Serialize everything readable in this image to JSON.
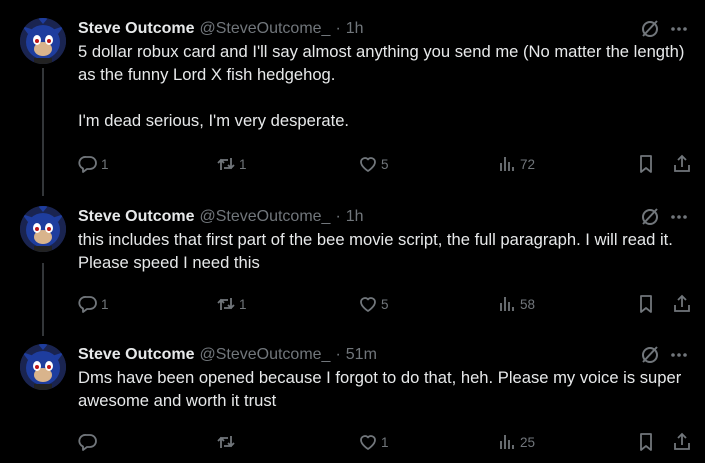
{
  "tweets": [
    {
      "name": "Steve Outcome",
      "handle": "@SteveOutcome_",
      "separator": "·",
      "time": "1h",
      "paragraphs": [
        "5 dollar robux card and I'll say almost anything you send me (No matter the length) as the funny Lord X fish hedgehog.",
        "I'm dead serious, I'm very desperate."
      ],
      "replies": "1",
      "reposts": "1",
      "likes": "5",
      "views": "72"
    },
    {
      "name": "Steve Outcome",
      "handle": "@SteveOutcome_",
      "separator": "·",
      "time": "1h",
      "paragraphs": [
        "this includes that first part of the bee movie script, the full paragraph. I will read it. Please speed I need this"
      ],
      "replies": "1",
      "reposts": "1",
      "likes": "5",
      "views": "58"
    },
    {
      "name": "Steve Outcome",
      "handle": "@SteveOutcome_",
      "separator": "·",
      "time": "51m",
      "paragraphs": [
        "Dms have been opened because I forgot to do that, heh. Please my voice is super awesome and worth it trust"
      ],
      "replies": "",
      "reposts": "",
      "likes": "1",
      "views": "25"
    }
  ],
  "icons": {
    "grok": "grok-slash-icon",
    "more": "more-dots-icon",
    "reply": "reply-icon",
    "repost": "repost-icon",
    "like": "like-heart-icon",
    "views": "views-bars-icon",
    "bookmark": "bookmark-icon",
    "share": "share-icon"
  },
  "colors": {
    "background": "#000000",
    "text": "#e7e9ea",
    "secondary": "#71767b",
    "thread_line": "#333639"
  }
}
